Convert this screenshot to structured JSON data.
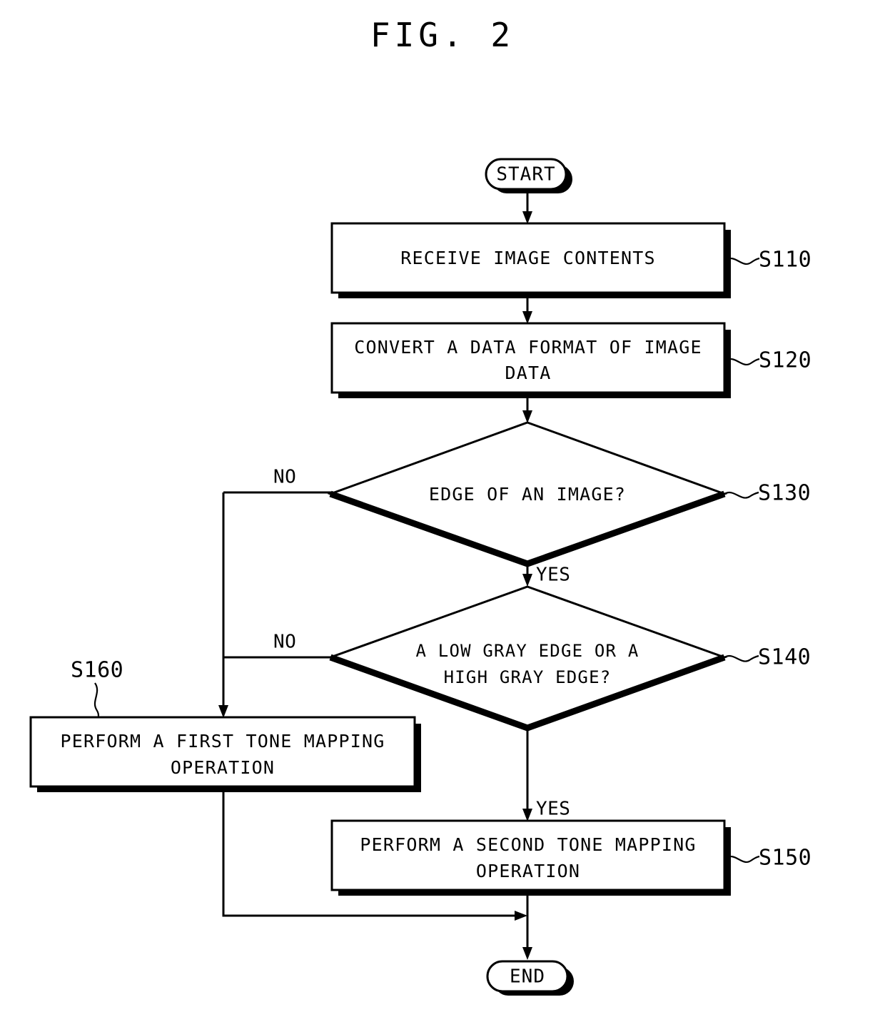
{
  "figure": {
    "title": "FIG. 2"
  },
  "flowchart": {
    "type": "flowchart",
    "nodes": [
      {
        "id": "start",
        "shape": "terminator",
        "label": "START",
        "ref": ""
      },
      {
        "id": "s110",
        "shape": "process",
        "label": "RECEIVE IMAGE CONTENTS",
        "ref": "S110"
      },
      {
        "id": "s120",
        "shape": "process",
        "label_line1": "CONVERT A DATA FORMAT OF IMAGE",
        "label_line2": "DATA",
        "ref": "S120"
      },
      {
        "id": "s130",
        "shape": "decision",
        "label": "EDGE OF AN IMAGE?",
        "ref": "S130"
      },
      {
        "id": "s140",
        "shape": "decision",
        "label_line1": "A LOW GRAY EDGE OR A",
        "label_line2": "HIGH GRAY EDGE?",
        "ref": "S140"
      },
      {
        "id": "s160",
        "shape": "process",
        "label_line1": "PERFORM A FIRST TONE MAPPING",
        "label_line2": "OPERATION",
        "ref": "S160"
      },
      {
        "id": "s150",
        "shape": "process",
        "label_line1": "PERFORM A SECOND TONE MAPPING",
        "label_line2": "OPERATION",
        "ref": "S150"
      },
      {
        "id": "end",
        "shape": "terminator",
        "label": "END",
        "ref": ""
      }
    ],
    "branch_labels": {
      "s130_no": "NO",
      "s130_yes": "YES",
      "s140_no": "NO",
      "s140_yes": "YES"
    },
    "edges": [
      {
        "from": "start",
        "to": "s110",
        "label": ""
      },
      {
        "from": "s110",
        "to": "s120",
        "label": ""
      },
      {
        "from": "s120",
        "to": "s130",
        "label": ""
      },
      {
        "from": "s130",
        "to": "s140",
        "label": "YES"
      },
      {
        "from": "s130",
        "to": "s160",
        "label": "NO"
      },
      {
        "from": "s140",
        "to": "s150",
        "label": "YES"
      },
      {
        "from": "s140",
        "to": "s160",
        "label": "NO"
      },
      {
        "from": "s160",
        "to": "end",
        "label": ""
      },
      {
        "from": "s150",
        "to": "end",
        "label": ""
      }
    ]
  },
  "colors": {
    "ink": "#000000",
    "paper": "#ffffff"
  }
}
